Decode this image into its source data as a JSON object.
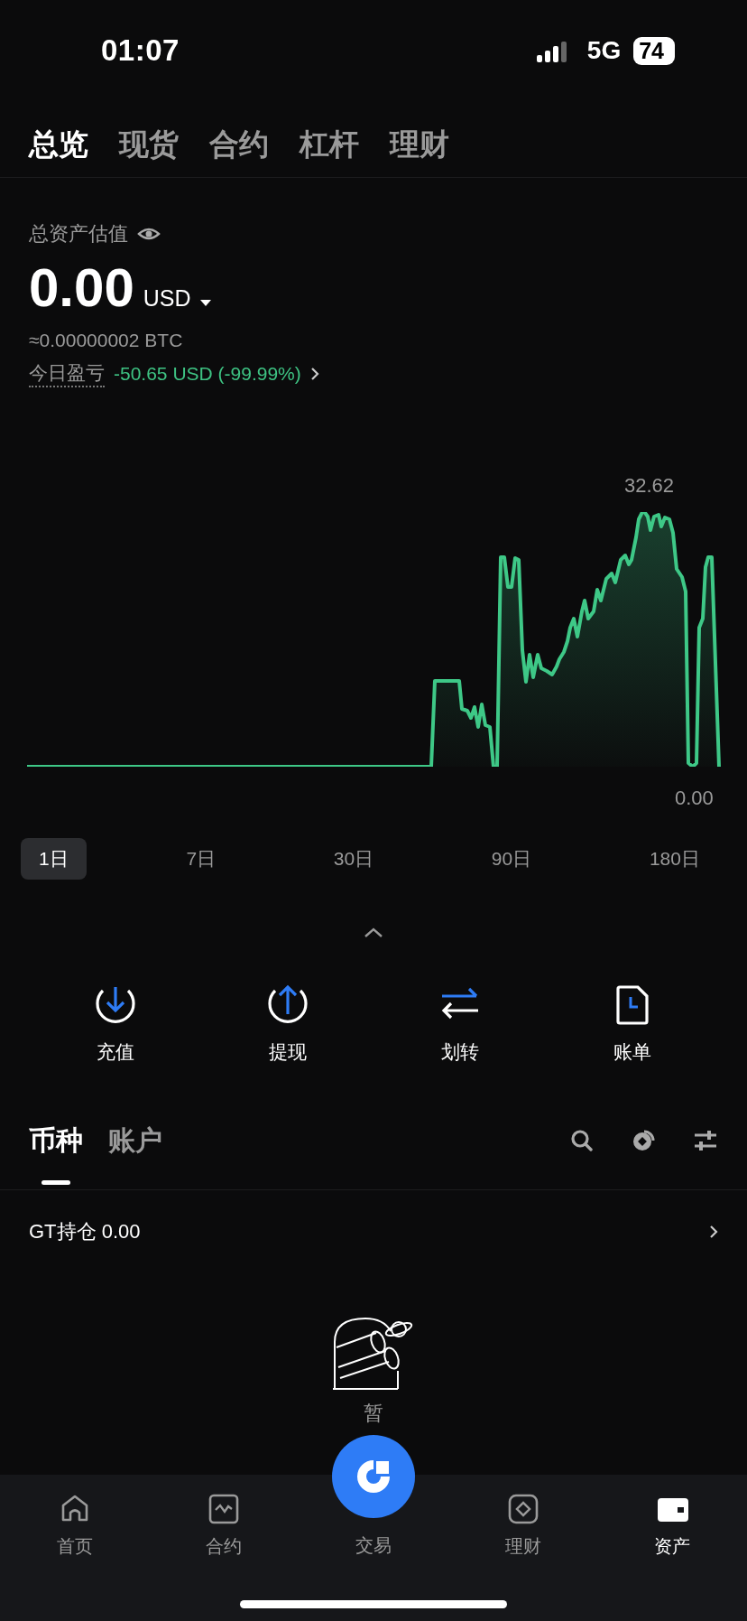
{
  "status_bar": {
    "time": "01:07",
    "network": "5G",
    "battery": "74"
  },
  "tabs": [
    {
      "label": "总览",
      "selected": true
    },
    {
      "label": "现货",
      "selected": false
    },
    {
      "label": "合约",
      "selected": false
    },
    {
      "label": "杠杆",
      "selected": false
    },
    {
      "label": "理财",
      "selected": false
    }
  ],
  "summary": {
    "label": "总资产估值",
    "value": "0.00",
    "currency": "USD",
    "btc_equivalent": "≈0.00000002 BTC",
    "pnl_label": "今日盈亏",
    "pnl_value": "-50.65 USD (-99.99%)"
  },
  "chart": {
    "max_label": "32.62",
    "min_label": "0.00"
  },
  "periods": [
    {
      "label": "1日",
      "selected": true
    },
    {
      "label": "7日",
      "selected": false
    },
    {
      "label": "30日",
      "selected": false
    },
    {
      "label": "90日",
      "selected": false
    },
    {
      "label": "180日",
      "selected": false
    }
  ],
  "actions": [
    {
      "label": "充值",
      "kind": "deposit"
    },
    {
      "label": "提现",
      "kind": "withdraw"
    },
    {
      "label": "划转",
      "kind": "transfer"
    },
    {
      "label": "账单",
      "kind": "bill"
    }
  ],
  "asset_tabs": [
    {
      "label": "币种",
      "selected": true
    },
    {
      "label": "账户",
      "selected": false
    }
  ],
  "gt_holding": "GT持仓 0.00",
  "empty_state": "暂",
  "bottom_nav": [
    {
      "label": "首页",
      "kind": "home",
      "selected": false
    },
    {
      "label": "合约",
      "kind": "futures",
      "selected": false
    },
    {
      "label": "交易",
      "kind": "trade",
      "selected": false
    },
    {
      "label": "理财",
      "kind": "earn",
      "selected": false
    },
    {
      "label": "资产",
      "kind": "assets",
      "selected": true
    }
  ]
}
